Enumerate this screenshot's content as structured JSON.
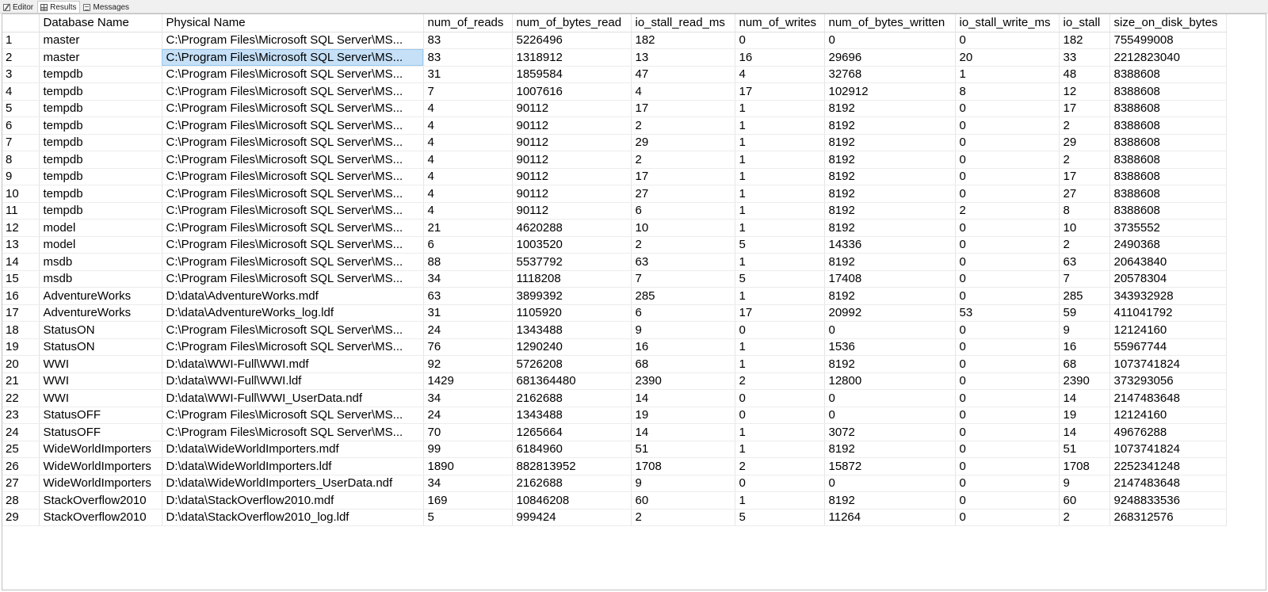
{
  "tabs": [
    {
      "label": "Editor",
      "icon": "editor-icon",
      "active": false
    },
    {
      "label": "Results",
      "icon": "grid-icon",
      "active": true
    },
    {
      "label": "Messages",
      "icon": "messages-icon",
      "active": false
    }
  ],
  "results": {
    "columns": [
      "Database Name",
      "Physical Name",
      "num_of_reads",
      "num_of_bytes_read",
      "io_stall_read_ms",
      "num_of_writes",
      "num_of_bytes_written",
      "io_stall_write_ms",
      "io_stall",
      "size_on_disk_bytes"
    ],
    "selected_cell": {
      "row": 1,
      "col": 1
    },
    "selection_color": "#c5e0f7",
    "rows": [
      [
        "1",
        "master",
        "C:\\Program Files\\Microsoft SQL Server\\MS...",
        "83",
        "5226496",
        "182",
        "0",
        "0",
        "0",
        "182",
        "755499008"
      ],
      [
        "2",
        "master",
        "C:\\Program Files\\Microsoft SQL Server\\MS...",
        "83",
        "1318912",
        "13",
        "16",
        "29696",
        "20",
        "33",
        "2212823040"
      ],
      [
        "3",
        "tempdb",
        "C:\\Program Files\\Microsoft SQL Server\\MS...",
        "31",
        "1859584",
        "47",
        "4",
        "32768",
        "1",
        "48",
        "8388608"
      ],
      [
        "4",
        "tempdb",
        "C:\\Program Files\\Microsoft SQL Server\\MS...",
        "7",
        "1007616",
        "4",
        "17",
        "102912",
        "8",
        "12",
        "8388608"
      ],
      [
        "5",
        "tempdb",
        "C:\\Program Files\\Microsoft SQL Server\\MS...",
        "4",
        "90112",
        "17",
        "1",
        "8192",
        "0",
        "17",
        "8388608"
      ],
      [
        "6",
        "tempdb",
        "C:\\Program Files\\Microsoft SQL Server\\MS...",
        "4",
        "90112",
        "2",
        "1",
        "8192",
        "0",
        "2",
        "8388608"
      ],
      [
        "7",
        "tempdb",
        "C:\\Program Files\\Microsoft SQL Server\\MS...",
        "4",
        "90112",
        "29",
        "1",
        "8192",
        "0",
        "29",
        "8388608"
      ],
      [
        "8",
        "tempdb",
        "C:\\Program Files\\Microsoft SQL Server\\MS...",
        "4",
        "90112",
        "2",
        "1",
        "8192",
        "0",
        "2",
        "8388608"
      ],
      [
        "9",
        "tempdb",
        "C:\\Program Files\\Microsoft SQL Server\\MS...",
        "4",
        "90112",
        "17",
        "1",
        "8192",
        "0",
        "17",
        "8388608"
      ],
      [
        "10",
        "tempdb",
        "C:\\Program Files\\Microsoft SQL Server\\MS...",
        "4",
        "90112",
        "27",
        "1",
        "8192",
        "0",
        "27",
        "8388608"
      ],
      [
        "11",
        "tempdb",
        "C:\\Program Files\\Microsoft SQL Server\\MS...",
        "4",
        "90112",
        "6",
        "1",
        "8192",
        "2",
        "8",
        "8388608"
      ],
      [
        "12",
        "model",
        "C:\\Program Files\\Microsoft SQL Server\\MS...",
        "21",
        "4620288",
        "10",
        "1",
        "8192",
        "0",
        "10",
        "3735552"
      ],
      [
        "13",
        "model",
        "C:\\Program Files\\Microsoft SQL Server\\MS...",
        "6",
        "1003520",
        "2",
        "5",
        "14336",
        "0",
        "2",
        "2490368"
      ],
      [
        "14",
        "msdb",
        "C:\\Program Files\\Microsoft SQL Server\\MS...",
        "88",
        "5537792",
        "63",
        "1",
        "8192",
        "0",
        "63",
        "20643840"
      ],
      [
        "15",
        "msdb",
        "C:\\Program Files\\Microsoft SQL Server\\MS...",
        "34",
        "1118208",
        "7",
        "5",
        "17408",
        "0",
        "7",
        "20578304"
      ],
      [
        "16",
        "AdventureWorks",
        "D:\\data\\AdventureWorks.mdf",
        "63",
        "3899392",
        "285",
        "1",
        "8192",
        "0",
        "285",
        "343932928"
      ],
      [
        "17",
        "AdventureWorks",
        "D:\\data\\AdventureWorks_log.ldf",
        "31",
        "1105920",
        "6",
        "17",
        "20992",
        "53",
        "59",
        "411041792"
      ],
      [
        "18",
        "StatusON",
        "C:\\Program Files\\Microsoft SQL Server\\MS...",
        "24",
        "1343488",
        "9",
        "0",
        "0",
        "0",
        "9",
        "12124160"
      ],
      [
        "19",
        "StatusON",
        "C:\\Program Files\\Microsoft SQL Server\\MS...",
        "76",
        "1290240",
        "16",
        "1",
        "1536",
        "0",
        "16",
        "55967744"
      ],
      [
        "20",
        "WWI",
        "D:\\data\\WWI-Full\\WWI.mdf",
        "92",
        "5726208",
        "68",
        "1",
        "8192",
        "0",
        "68",
        "1073741824"
      ],
      [
        "21",
        "WWI",
        "D:\\data\\WWI-Full\\WWI.ldf",
        "1429",
        "681364480",
        "2390",
        "2",
        "12800",
        "0",
        "2390",
        "373293056"
      ],
      [
        "22",
        "WWI",
        "D:\\data\\WWI-Full\\WWI_UserData.ndf",
        "34",
        "2162688",
        "14",
        "0",
        "0",
        "0",
        "14",
        "2147483648"
      ],
      [
        "23",
        "StatusOFF",
        "C:\\Program Files\\Microsoft SQL Server\\MS...",
        "24",
        "1343488",
        "19",
        "0",
        "0",
        "0",
        "19",
        "12124160"
      ],
      [
        "24",
        "StatusOFF",
        "C:\\Program Files\\Microsoft SQL Server\\MS...",
        "70",
        "1265664",
        "14",
        "1",
        "3072",
        "0",
        "14",
        "49676288"
      ],
      [
        "25",
        "WideWorldImporters",
        "D:\\data\\WideWorldImporters.mdf",
        "99",
        "6184960",
        "51",
        "1",
        "8192",
        "0",
        "51",
        "1073741824"
      ],
      [
        "26",
        "WideWorldImporters",
        "D:\\data\\WideWorldImporters.ldf",
        "1890",
        "882813952",
        "1708",
        "2",
        "15872",
        "0",
        "1708",
        "2252341248"
      ],
      [
        "27",
        "WideWorldImporters",
        "D:\\data\\WideWorldImporters_UserData.ndf",
        "34",
        "2162688",
        "9",
        "0",
        "0",
        "0",
        "9",
        "2147483648"
      ],
      [
        "28",
        "StackOverflow2010",
        "D:\\data\\StackOverflow2010.mdf",
        "169",
        "10846208",
        "60",
        "1",
        "8192",
        "0",
        "60",
        "9248833536"
      ],
      [
        "29",
        "StackOverflow2010",
        "D:\\data\\StackOverflow2010_log.ldf",
        "5",
        "999424",
        "2",
        "5",
        "11264",
        "0",
        "2",
        "268312576"
      ]
    ]
  }
}
